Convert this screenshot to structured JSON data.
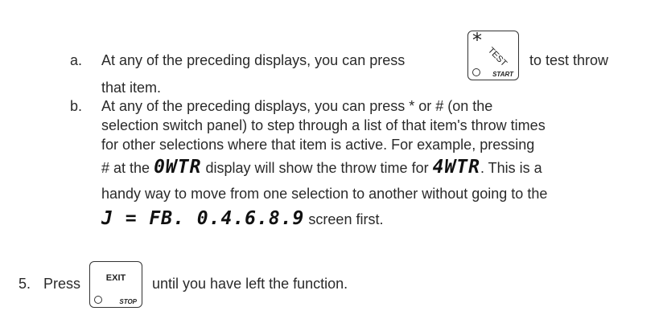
{
  "items": {
    "a": {
      "marker": "a.",
      "line1_before": "At any of the preceding displays, you can press",
      "line1_after": "to test throw",
      "line2": "that item."
    },
    "b": {
      "marker": "b.",
      "line1": "At any of the preceding displays, you can press * or # (on the",
      "line2": "selection switch panel) to step through a list of that item's throw times",
      "line3": "for other selections where that item is active.  For example, pressing",
      "line4_pre": "# at the",
      "lcd_0wtr": "0WTR",
      "line4_mid": "display will show the throw time for",
      "lcd_4wtr": "4WTR",
      "line4_post": ".  This is a",
      "line5": "handy way to move from one selection to another without going to the",
      "lcd_screen": "J = FB. 0.4.6.8.9",
      "line6_post": "screen first."
    }
  },
  "step5": {
    "marker": "5.",
    "before": "Press",
    "after": "until you have left the function."
  },
  "keys": {
    "test": {
      "symbol": "*",
      "label": "TEST",
      "sub": "START"
    },
    "exit": {
      "label": "EXIT",
      "sub": "STOP"
    }
  }
}
